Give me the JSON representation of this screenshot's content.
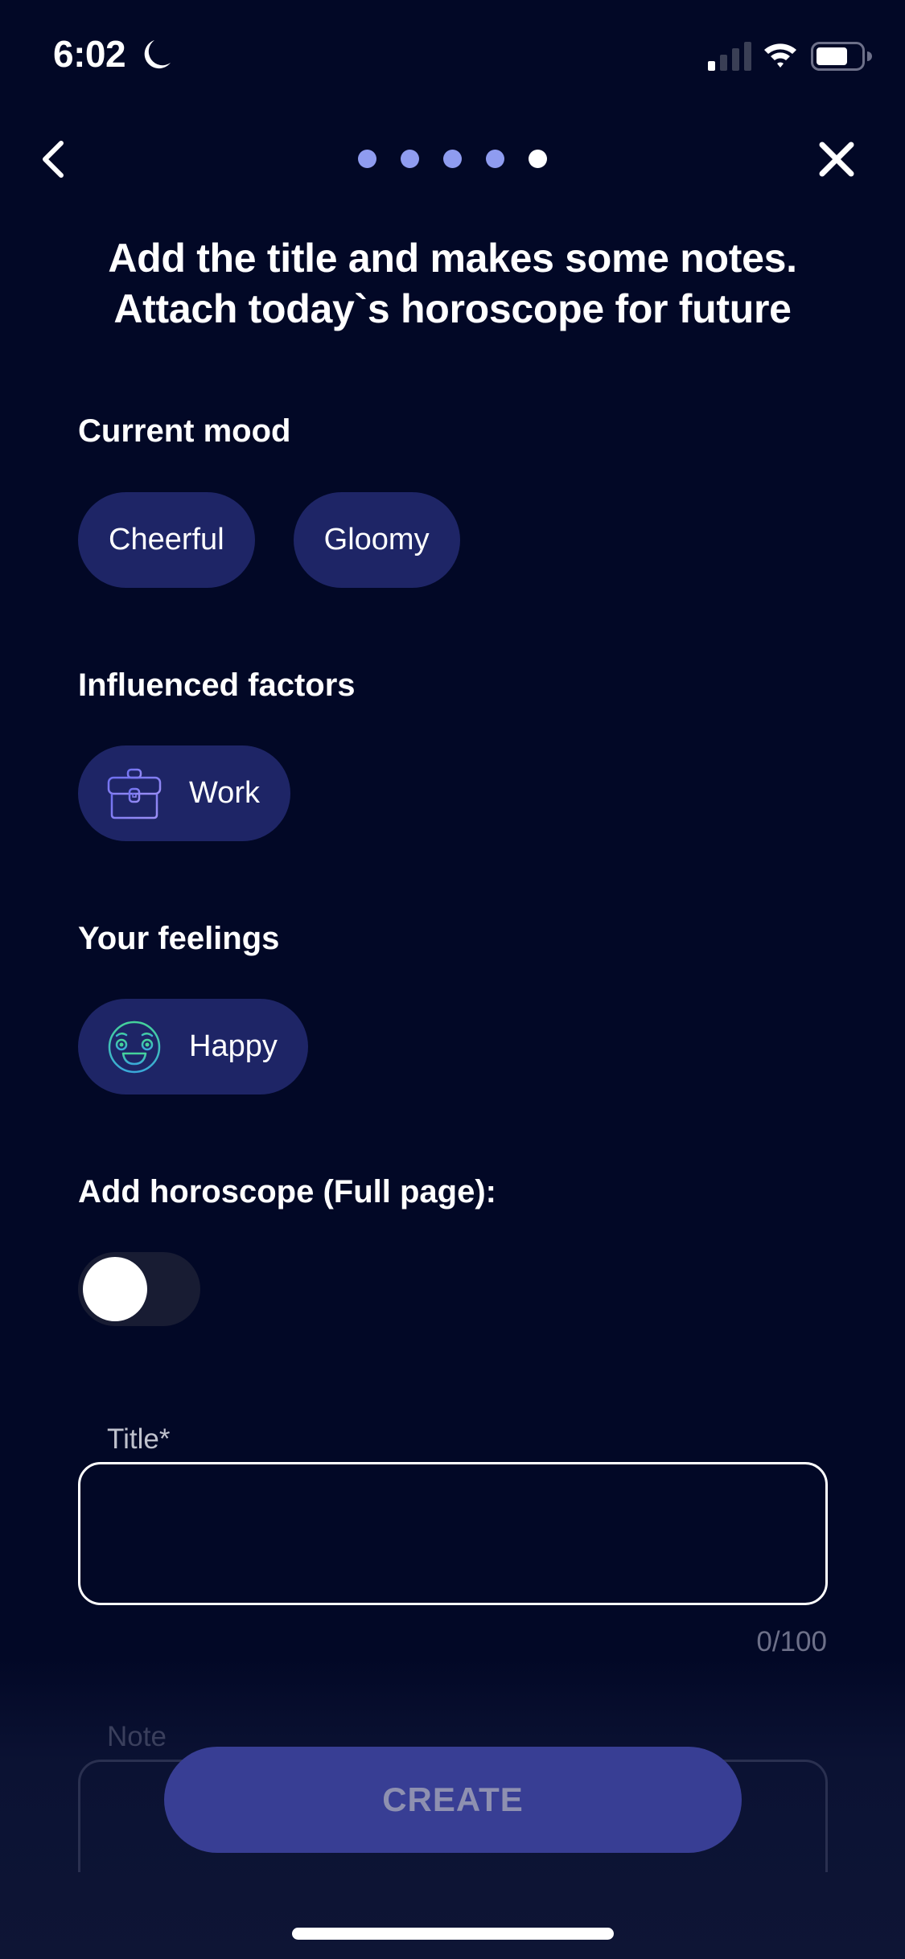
{
  "status_bar": {
    "time": "6:02",
    "focus_icon": "moon-icon",
    "signal_bars_active": 1,
    "signal_bars_total": 4,
    "battery_level_percent": 70
  },
  "nav": {
    "back_icon": "chevron-left-icon",
    "close_icon": "close-icon",
    "steps_total": 5,
    "current_step": 5
  },
  "headline": {
    "line1": "Add the title and makes some notes.",
    "line2": "Attach today`s horoscope for future"
  },
  "sections": {
    "mood": {
      "label": "Current mood",
      "chips": [
        {
          "label": "Cheerful"
        },
        {
          "label": "Gloomy"
        }
      ]
    },
    "factors": {
      "label": "Influenced factors",
      "chips": [
        {
          "label": "Work",
          "icon": "briefcase-icon"
        }
      ]
    },
    "feelings": {
      "label": "Your feelings",
      "chips": [
        {
          "label": "Happy",
          "icon": "happy-face-icon"
        }
      ]
    },
    "horoscope": {
      "label": "Add horoscope (Full page):",
      "toggle_on": false
    }
  },
  "form": {
    "title_label": "Title*",
    "title_value": "",
    "title_counter": "0/100",
    "note_label": "Note"
  },
  "actions": {
    "create_label": "CREATE"
  },
  "colors": {
    "background": "#020826",
    "chip": "#1e2566",
    "step_dot": "#8f9cf0",
    "create_button": "#383e94",
    "icon_work": "#7b7ff0",
    "icon_happy": "#3fd6a6"
  }
}
